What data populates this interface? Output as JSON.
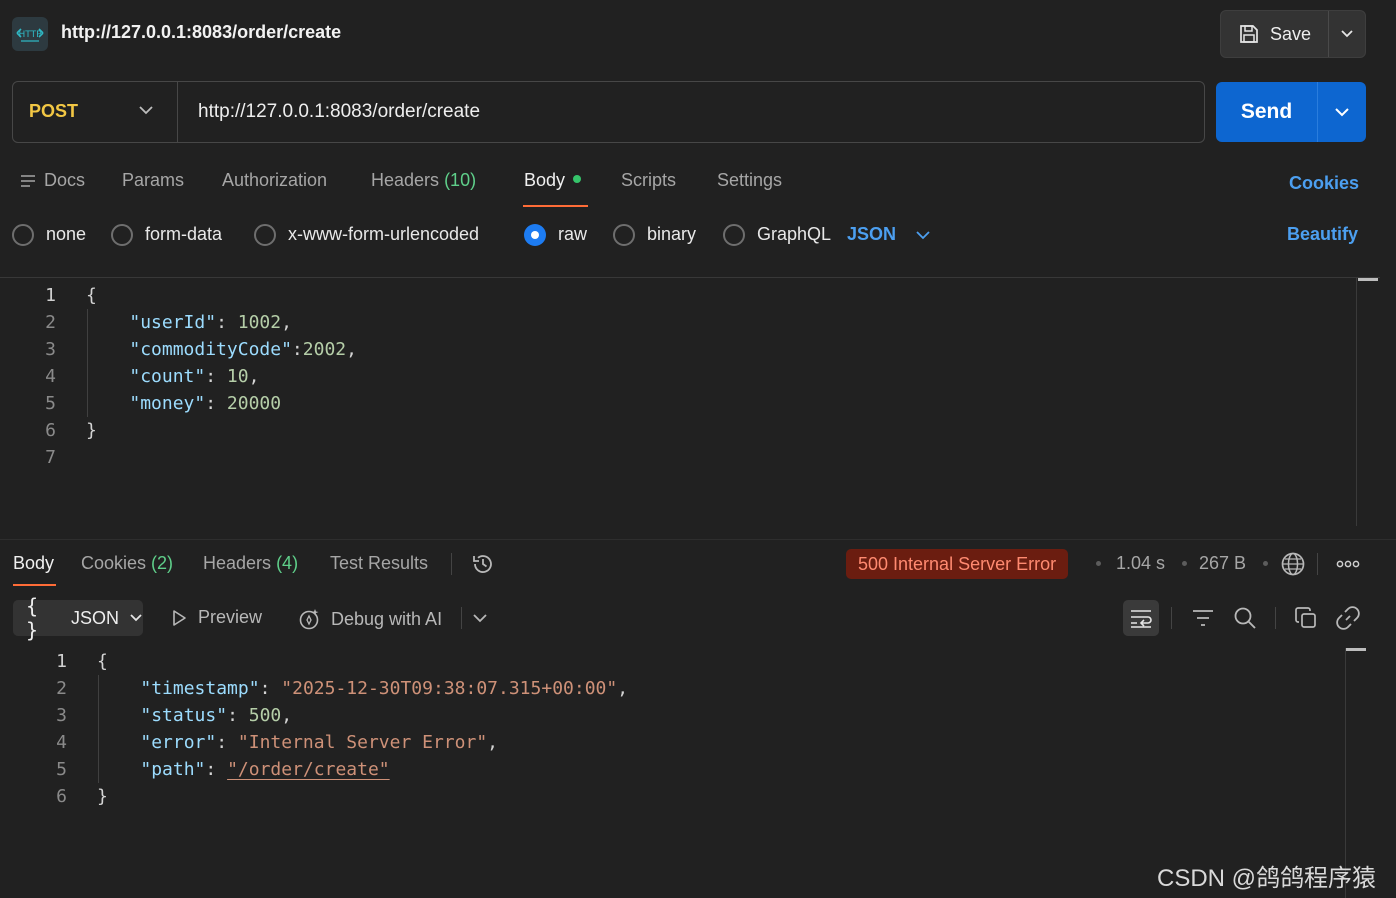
{
  "header": {
    "icon_text": "HTTP",
    "title": "http://127.0.0.1:8083/order/create",
    "save_label": "Save"
  },
  "request": {
    "method": "POST",
    "url": "http://127.0.0.1:8083/order/create",
    "send_label": "Send",
    "method_color": "#f2c744"
  },
  "tabs": {
    "docs": "Docs",
    "params": "Params",
    "authorization": "Authorization",
    "headers": "Headers",
    "headers_count": "(10)",
    "body": "Body",
    "scripts": "Scripts",
    "settings": "Settings",
    "cookies": "Cookies",
    "active": "Body"
  },
  "body_types": {
    "none": "none",
    "form_data": "form-data",
    "urlencoded": "x-www-form-urlencoded",
    "raw": "raw",
    "binary": "binary",
    "graphql": "GraphQL",
    "selected": "raw",
    "format": "JSON",
    "beautify": "Beautify"
  },
  "request_body": {
    "line_numbers": [
      "1",
      "2",
      "3",
      "4",
      "5",
      "6",
      "7"
    ],
    "open_brace": "{",
    "close_brace": "}",
    "fields": [
      {
        "key": "\"userId\"",
        "sep": ": ",
        "value": "1002",
        "tail": ","
      },
      {
        "key": "\"commodityCode\"",
        "sep": ":",
        "value": "2002",
        "tail": ","
      },
      {
        "key": "\"count\"",
        "sep": ": ",
        "value": "10",
        "tail": ","
      },
      {
        "key": "\"money\"",
        "sep": ": ",
        "value": "20000",
        "tail": ""
      }
    ]
  },
  "response": {
    "tabs": {
      "body": "Body",
      "cookies": "Cookies",
      "cookies_count": "(2)",
      "headers": "Headers",
      "headers_count": "(4)",
      "test_results": "Test Results"
    },
    "status": "500 Internal Server Error",
    "time": "1.04 s",
    "size": "267 B",
    "toolbar": {
      "format": "JSON",
      "preview": "Preview",
      "debug": "Debug with AI"
    },
    "line_numbers": [
      "1",
      "2",
      "3",
      "4",
      "5",
      "6"
    ],
    "open_brace": "{",
    "close_brace": "}",
    "fields": [
      {
        "key": "\"timestamp\"",
        "sep": ": ",
        "value": "\"2025-12-30T09:38:07.315+00:00\"",
        "tail": ",",
        "type": "string"
      },
      {
        "key": "\"status\"",
        "sep": ": ",
        "value": "500",
        "tail": ",",
        "type": "number"
      },
      {
        "key": "\"error\"",
        "sep": ": ",
        "value": "\"Internal Server Error\"",
        "tail": ",",
        "type": "string"
      },
      {
        "key": "\"path\"",
        "sep": ": ",
        "value": "\"/order/create\"",
        "tail": "",
        "type": "link"
      }
    ]
  },
  "watermark": "CSDN @鸽鸽程序猿"
}
